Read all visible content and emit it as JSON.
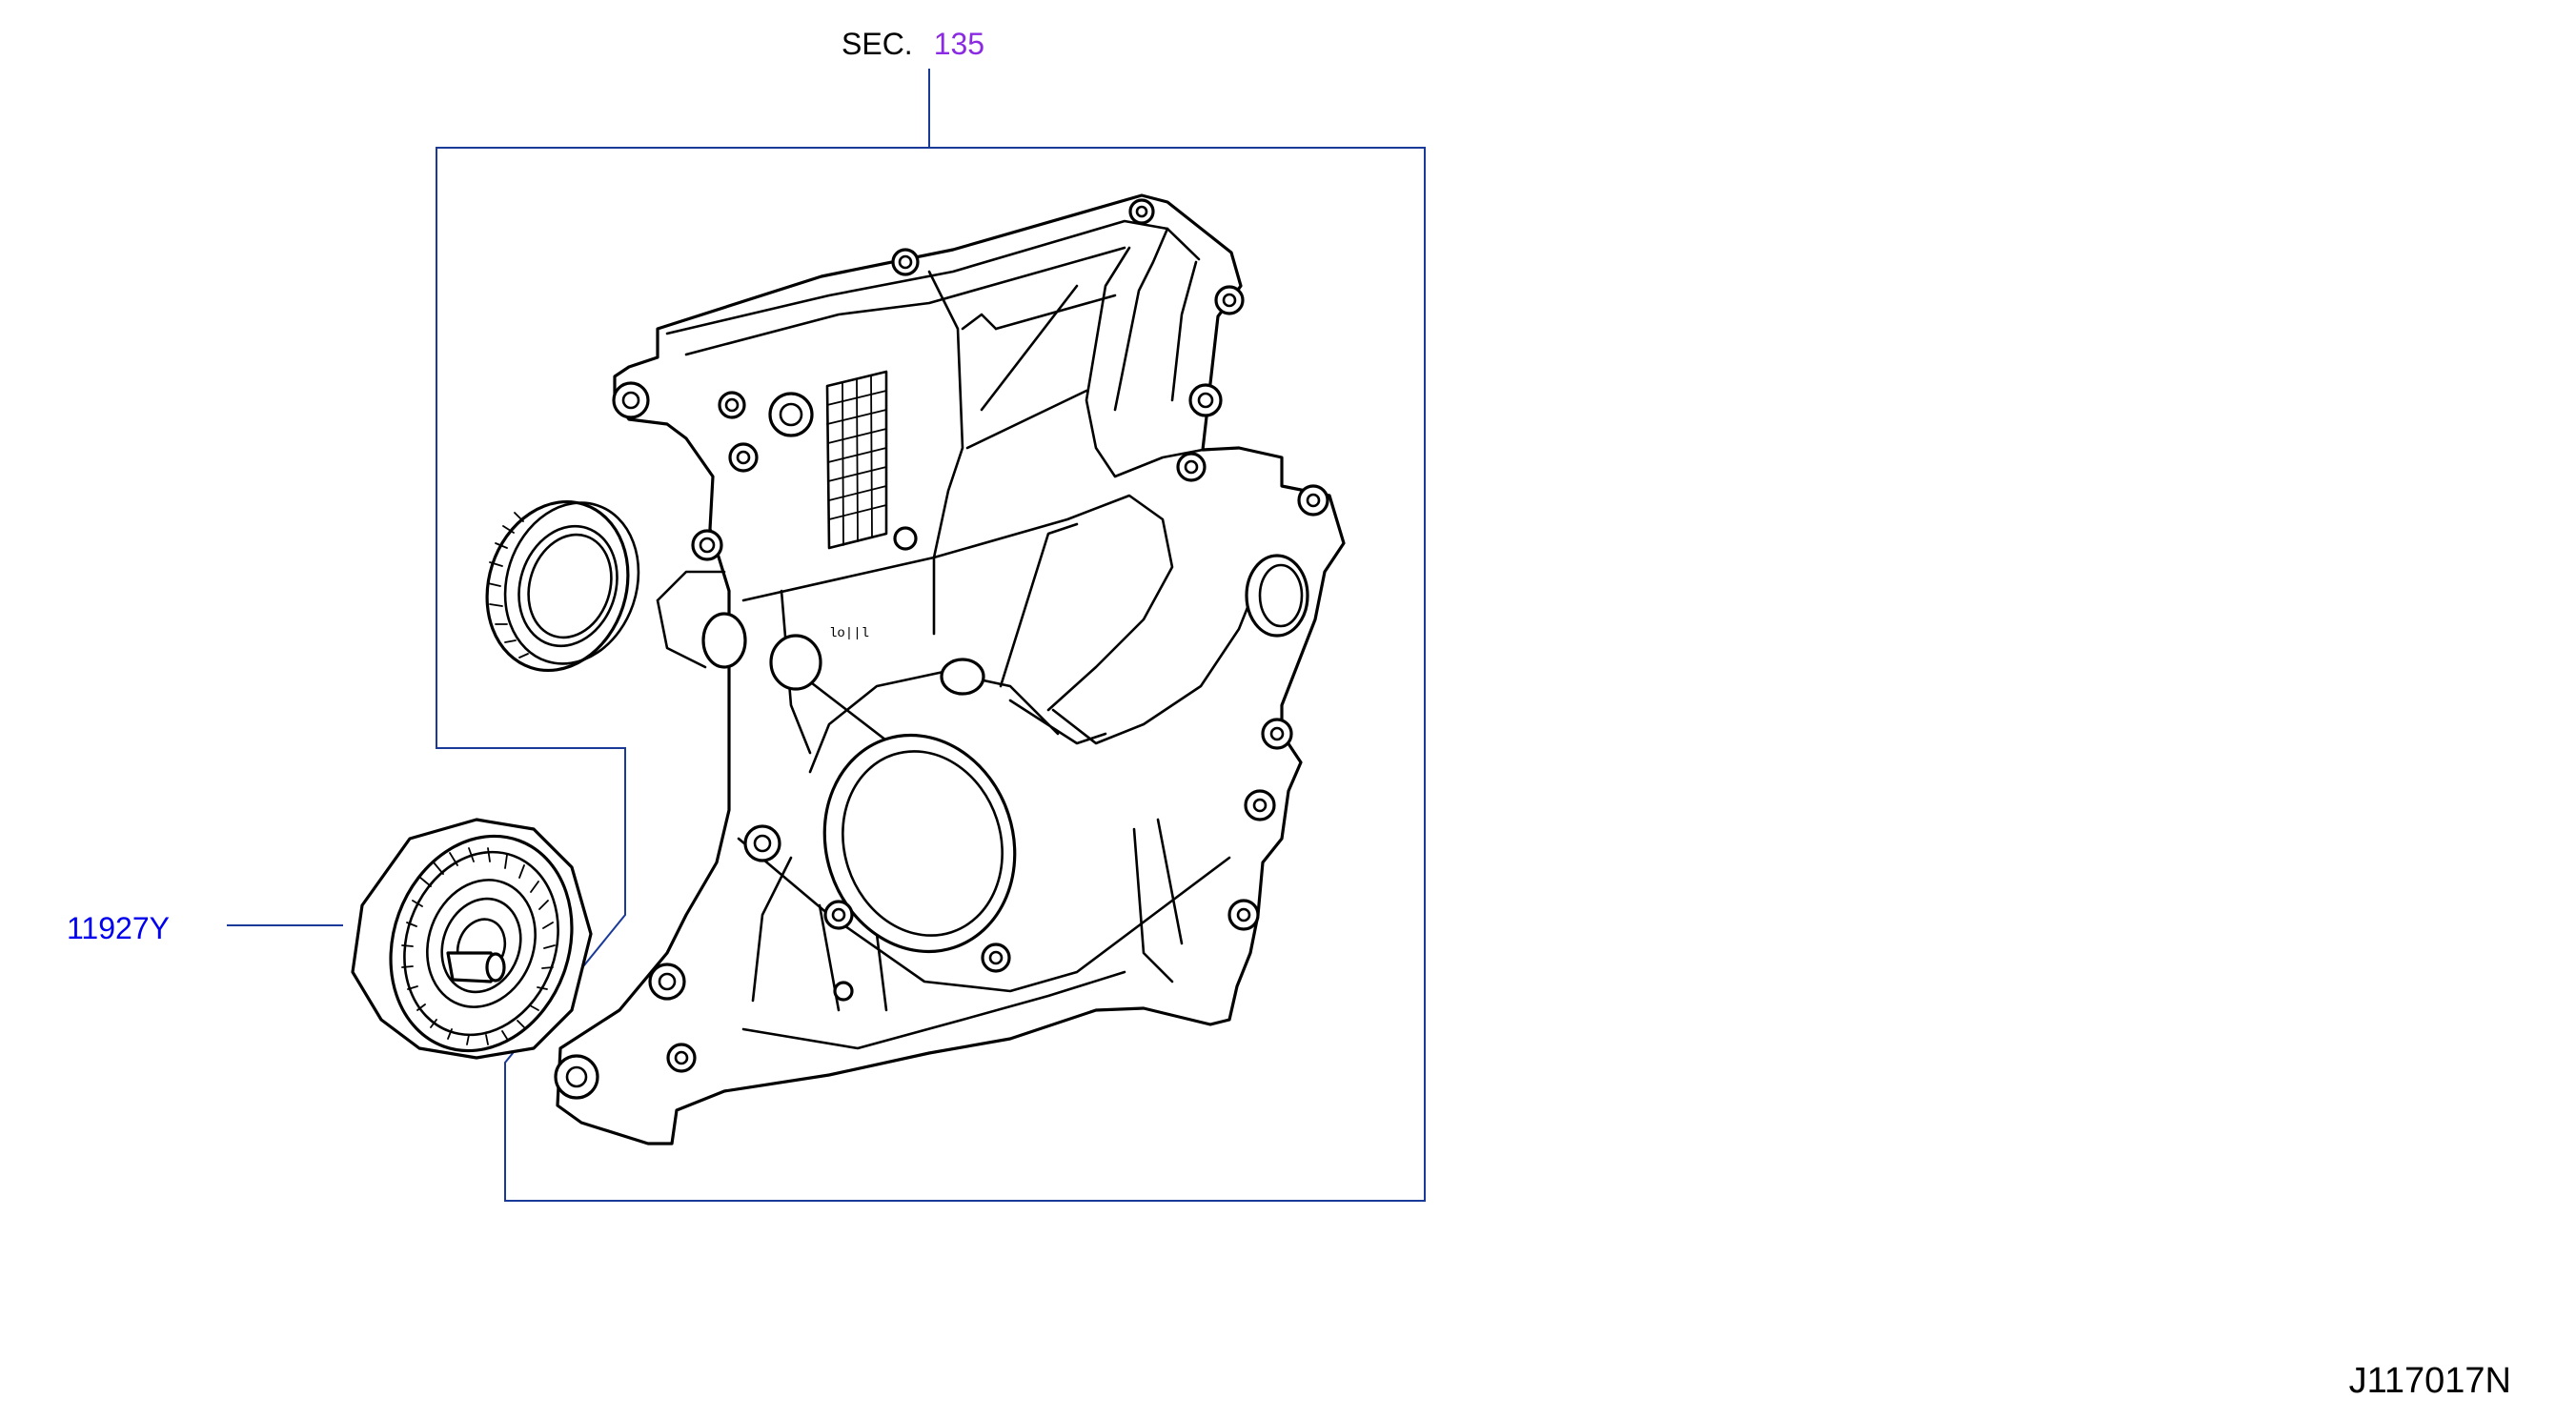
{
  "section_ref": {
    "prefix": "SEC.",
    "number": "135"
  },
  "parts": [
    {
      "number": "11927Y"
    }
  ],
  "diagram_id": "J117017N",
  "colors": {
    "callout_blue": "#0000ee",
    "section_purple": "#8a2be2",
    "leader_line": "#1a3a9a",
    "drawing_ink": "#000000",
    "background": "#ffffff"
  },
  "icons": {
    "front_cover": "engine-front-timing-cover-icon",
    "oil_seal": "crankshaft-oil-seal-icon",
    "idler_pulley": "idler-pulley-icon"
  }
}
